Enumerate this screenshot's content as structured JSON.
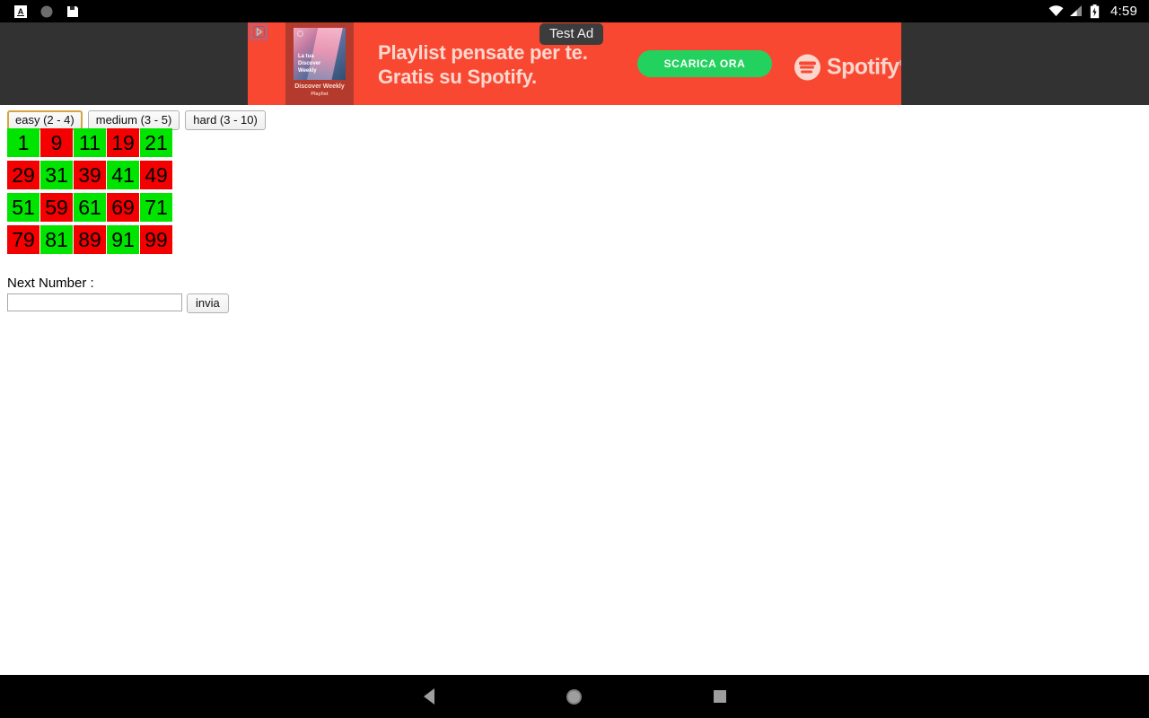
{
  "status_bar": {
    "icons_left": [
      "app-notification-icon",
      "circle-notification-icon",
      "save-notification-icon"
    ],
    "icons_right": [
      "wifi-icon",
      "signal-icon",
      "battery-icon"
    ],
    "time": "4:59"
  },
  "ad": {
    "adchoices_label": "AdChoices",
    "badge_label": "Test Ad",
    "headline_line1": "Playlist pensate per te.",
    "headline_line2": "Gratis su Spotify.",
    "cta_label": "SCARICA ORA",
    "brand": "Spotify",
    "brand_trademark": "®",
    "artwork": {
      "overlay_line1": "La tua",
      "overlay_line2": "Discover",
      "overlay_line3": "Weekly",
      "caption": "Discover Weekly",
      "caption_sub": "Playlist"
    },
    "colors": {
      "background": "#f94831",
      "cta": "#23d25e",
      "text": "#fdd8cf",
      "badge_bg": "#3c3c3c"
    }
  },
  "page": {
    "difficulty_buttons": [
      {
        "label": "easy (2 - 4)",
        "focused": true
      },
      {
        "label": "medium (3 - 5)",
        "focused": false
      },
      {
        "label": "hard (3 - 10)",
        "focused": false
      }
    ],
    "grid": {
      "rows": 4,
      "columns": 5,
      "colors": {
        "green": "#00e400",
        "red": "#f40000"
      },
      "cells": [
        {
          "value": "1",
          "color": "green"
        },
        {
          "value": "9",
          "color": "red"
        },
        {
          "value": "11",
          "color": "green"
        },
        {
          "value": "19",
          "color": "red"
        },
        {
          "value": "21",
          "color": "green"
        },
        {
          "value": "29",
          "color": "red"
        },
        {
          "value": "31",
          "color": "green"
        },
        {
          "value": "39",
          "color": "red"
        },
        {
          "value": "41",
          "color": "green"
        },
        {
          "value": "49",
          "color": "red"
        },
        {
          "value": "51",
          "color": "green"
        },
        {
          "value": "59",
          "color": "red"
        },
        {
          "value": "61",
          "color": "green"
        },
        {
          "value": "69",
          "color": "red"
        },
        {
          "value": "71",
          "color": "green"
        },
        {
          "value": "79",
          "color": "red"
        },
        {
          "value": "81",
          "color": "green"
        },
        {
          "value": "89",
          "color": "red"
        },
        {
          "value": "91",
          "color": "green"
        },
        {
          "value": "99",
          "color": "red"
        }
      ]
    },
    "next_number_label": "Next Number :",
    "next_number_value": "",
    "next_number_placeholder": "",
    "submit_label": "invia"
  },
  "nav_bar": {
    "back_label": "Back",
    "home_label": "Home",
    "recents_label": "Recent apps"
  }
}
